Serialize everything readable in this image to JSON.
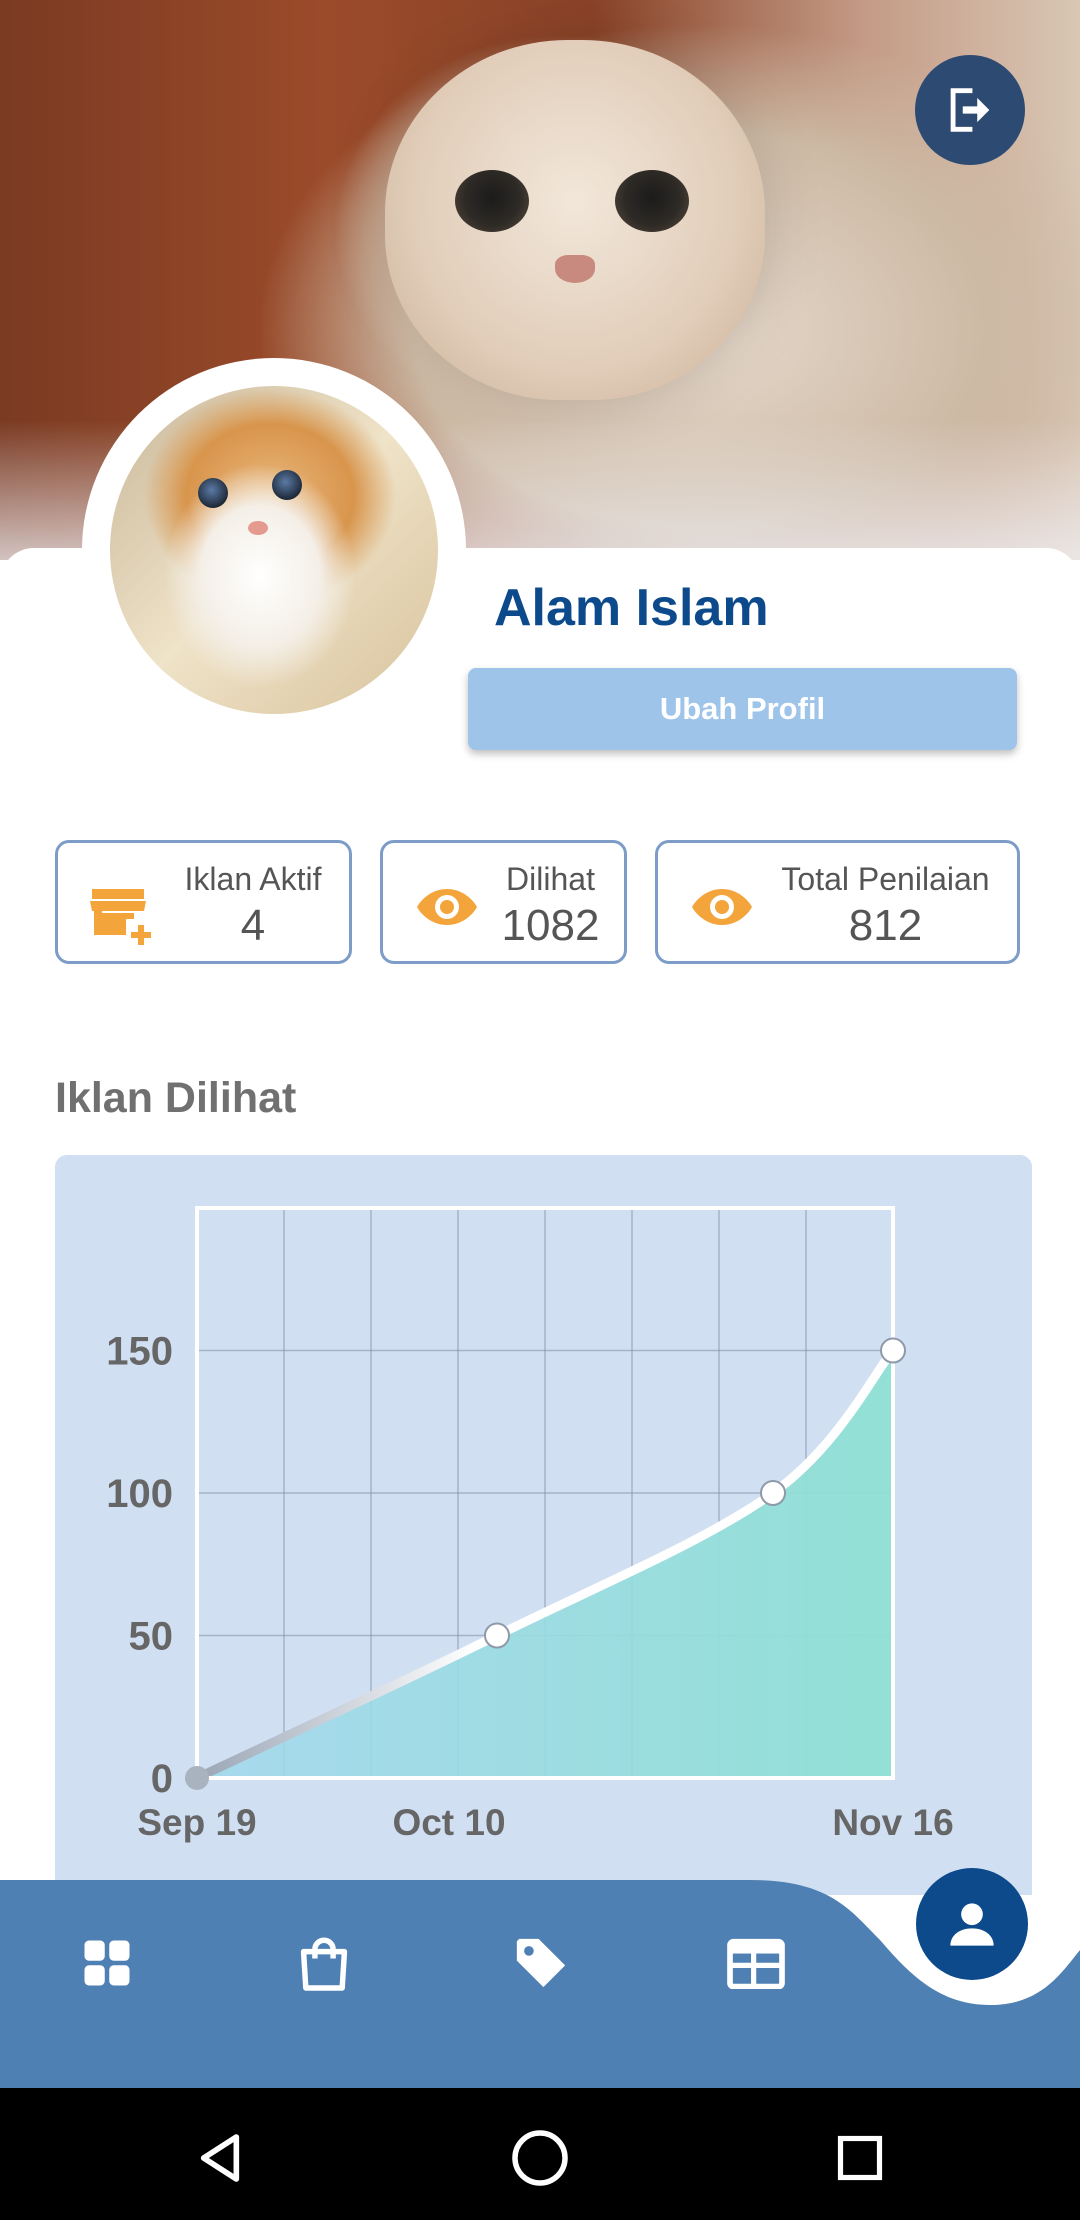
{
  "profile": {
    "name": "Alam Islam",
    "edit_label": "Ubah Profil"
  },
  "stats": [
    {
      "label": "Iklan Aktif",
      "value": "4",
      "icon": "store-add-icon"
    },
    {
      "label": "Dilihat",
      "value": "1082",
      "icon": "eye-icon"
    },
    {
      "label": "Total Penilaian",
      "value": "812",
      "icon": "eye-icon"
    }
  ],
  "colors": {
    "primary": "#0d4a8c",
    "nav": "#4f80b3",
    "accent": "#f3a43a",
    "chart_fill": "#8fdbd6",
    "chart_bg": "#d1dff3"
  },
  "section": {
    "chart_title": "Iklan Dilihat"
  },
  "chart_data": {
    "type": "area",
    "title": "Iklan Dilihat",
    "x_ticks": [
      "Sep 19",
      "Oct 10",
      "Nov 16"
    ],
    "y_ticks": [
      0,
      50,
      100,
      150
    ],
    "ylim": [
      0,
      200
    ],
    "grid": true,
    "series": [
      {
        "points": [
          {
            "x": "Sep 19",
            "y": 0
          },
          {
            "x": "Oct 14",
            "y": 50
          },
          {
            "x": "Nov 6",
            "y": 100
          },
          {
            "x": "Nov 16",
            "y": 150
          }
        ]
      }
    ]
  },
  "nav": {
    "items": [
      {
        "name": "dashboard",
        "icon": "grid-icon"
      },
      {
        "name": "shop",
        "icon": "shopping-bag-icon"
      },
      {
        "name": "deals",
        "icon": "tag-icon"
      },
      {
        "name": "listings",
        "icon": "table-icon"
      },
      {
        "name": "profile",
        "icon": "person-icon"
      }
    ]
  }
}
